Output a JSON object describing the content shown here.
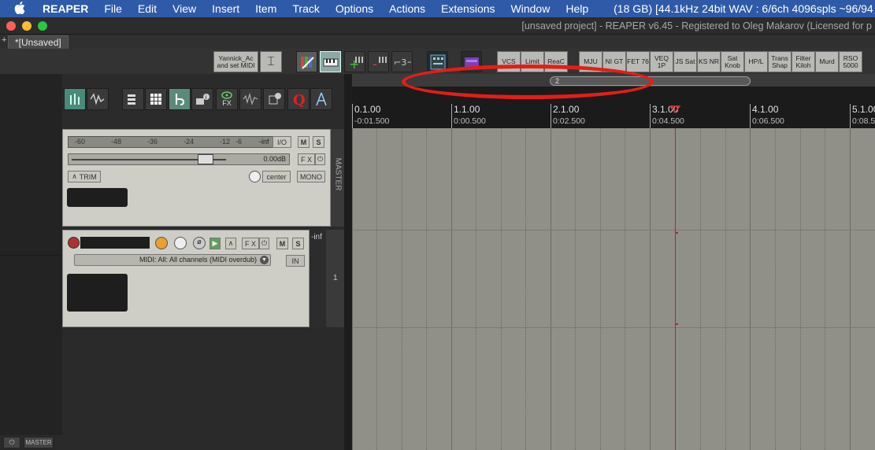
{
  "menubar": {
    "app": "REAPER",
    "items": [
      "File",
      "Edit",
      "View",
      "Insert",
      "Item",
      "Track",
      "Options",
      "Actions",
      "Extensions",
      "Window",
      "Help"
    ],
    "status": "(18 GB) [44.1kHz 24bit WAV : 6/6ch 4096spls ~96/94"
  },
  "window": {
    "title": "[unsaved project] - REAPER v6.45 - Registered to Oleg Makarov (Licensed for p"
  },
  "tabs": {
    "plus": "+",
    "project_tab": "*[Unsaved]"
  },
  "toolbar": {
    "yannick_label": "Yannick_Ac and set MIDI",
    "text_buttons": [
      {
        "key": "vcs",
        "label": "VCS"
      },
      {
        "key": "limit",
        "label": "Limit"
      },
      {
        "key": "reac",
        "label": "ReaC"
      },
      {
        "key": "mju",
        "label": "MJU"
      },
      {
        "key": "nigt",
        "label": "NI GT"
      },
      {
        "key": "fet76",
        "label": "FET 76"
      },
      {
        "key": "veq1p",
        "label": "VEQ 1P"
      },
      {
        "key": "jssat",
        "label": "JS Sat"
      },
      {
        "key": "ksnr",
        "label": "KS NR"
      },
      {
        "key": "satknob",
        "label": "Sat Knob"
      },
      {
        "key": "hpl",
        "label": "HP/L"
      },
      {
        "key": "transshap",
        "label": "Trans Shap"
      },
      {
        "key": "filterkiloh",
        "label": "Filter Kiloh"
      },
      {
        "key": "murd",
        "label": "Murd"
      },
      {
        "key": "rso5000",
        "label": "RSO 5000"
      }
    ]
  },
  "tcp_tools": {
    "fx_label": "FX"
  },
  "master": {
    "meter_scale": [
      "-60",
      "-48",
      "-36",
      "-24",
      "-12",
      "-6",
      "-inf"
    ],
    "io_label": "I/O",
    "m_label": "M",
    "s_label": "S",
    "volume": "0.00dB",
    "fx_label": "F X",
    "trim_label": "TRIM",
    "pan": "center",
    "mono_label": "MONO",
    "side_label": "MASTER"
  },
  "track1": {
    "m_label": "M",
    "s_label": "S",
    "fx_label": "F X",
    "input": "MIDI: All: All channels (MIDI overdub)",
    "in_label": "IN",
    "meter_value": "-inf",
    "number": "1"
  },
  "ruler": {
    "region_label": "2",
    "marks": [
      {
        "bar": "0.1.00",
        "time": "-0:01.500"
      },
      {
        "bar": "1.1.00",
        "time": "0:00.500"
      },
      {
        "bar": "2.1.00",
        "time": "0:02.500"
      },
      {
        "bar": "3.1.00",
        "time": "0:04.500"
      },
      {
        "bar": "4.1.00",
        "time": "0:06.500"
      },
      {
        "bar": "5.1.00",
        "time": "0:08.500"
      }
    ]
  },
  "bottom": {
    "master_label": "MASTER"
  },
  "colors": {
    "menubar": "#2f5aa8",
    "annotation": "#e51d16",
    "cursor": "#c81e1e",
    "arrange_bg": "#909089"
  }
}
